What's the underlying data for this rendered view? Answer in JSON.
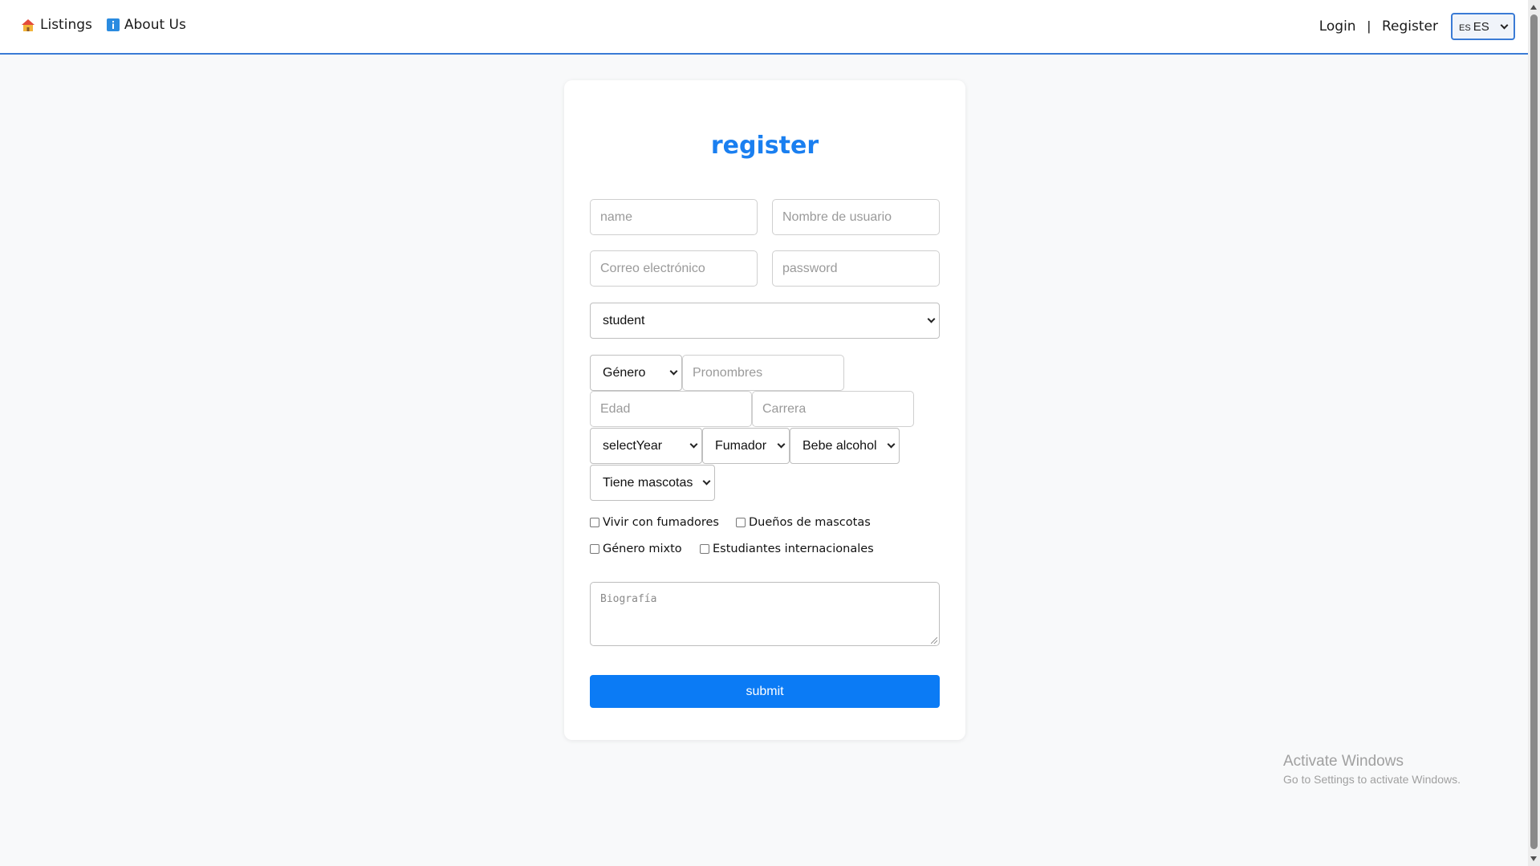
{
  "nav": {
    "listings_label": "Listings",
    "about_label": "About Us",
    "login_label": "Login",
    "separator": "|",
    "register_label": "Register",
    "language": {
      "flag": "ES",
      "value": "ES"
    }
  },
  "form": {
    "title": "register",
    "name_placeholder": "name",
    "username_placeholder": "Nombre de usuario",
    "email_placeholder": "Correo electrónico",
    "password_placeholder": "password",
    "role_value": "student",
    "gender_value": "Género",
    "pronouns_placeholder": "Pronombres",
    "age_placeholder": "Edad",
    "major_placeholder": "Carrera",
    "year_value": "selectYear",
    "smoker_value": "Fumador",
    "drinks_value": "Bebe alcohol",
    "pets_value": "Tiene mascotas",
    "checkboxes": [
      {
        "label": "Vivir con fumadores",
        "checked": false
      },
      {
        "label": "Dueños de mascotas",
        "checked": false
      },
      {
        "label": "Género mixto",
        "checked": false
      },
      {
        "label": "Estudiantes internacionales",
        "checked": false
      }
    ],
    "bio_placeholder": "Biografía",
    "submit_label": "submit"
  },
  "watermark": {
    "line1": "Activate Windows",
    "line2": "Go to Settings to activate Windows."
  },
  "colors": {
    "accent": "#1a7ff0",
    "submit_bg": "#0b7bf5",
    "nav_border": "#3a7bd5",
    "page_bg": "#f8f9fa"
  }
}
